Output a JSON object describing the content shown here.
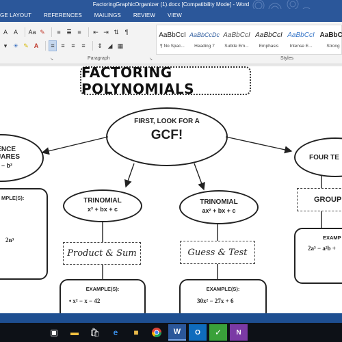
{
  "window": {
    "title": "FactoringGraphicOrganizer (1).docx [Compatibility Mode] - Word"
  },
  "ribbon": {
    "tabs": [
      "GE LAYOUT",
      "REFERENCES",
      "MAILINGS",
      "REVIEW",
      "VIEW"
    ],
    "groups": {
      "paragraph": "Paragraph",
      "styles": "Styles"
    },
    "font_row1": [
      "A",
      "A",
      "Aa",
      "✎"
    ],
    "styles_gallery": [
      {
        "sample": "AaBbCcI",
        "name": "¶ No Spac..."
      },
      {
        "sample": "AaBbCcDc",
        "name": "Heading 7"
      },
      {
        "sample": "AaBbCcI",
        "name": "Subtle Em..."
      },
      {
        "sample": "AaBbCcI",
        "name": "Emphasis"
      },
      {
        "sample": "AaBbCcI",
        "name": "Intense E..."
      },
      {
        "sample": "AaBbCc",
        "name": "Strong"
      }
    ]
  },
  "document": {
    "title": "FACTORING POLYNOMIALS",
    "gcf": {
      "line1": "FIRST, LOOK FOR A",
      "line2": "GCF!"
    },
    "left": {
      "line1": "RENCE",
      "line2": "UARES",
      "formula": "– b²",
      "example_label": "MPLE(S):",
      "example": "2n³"
    },
    "trinomial_a": {
      "title": "TRINOMIAL",
      "formula": "x² + bx + c",
      "method": "Product & Sum",
      "example_label": "EXAMPLE(S):",
      "example": "•  x² − x − 42"
    },
    "trinomial_b": {
      "title": "TRINOMIAL",
      "formula": "ax² + bx + c",
      "method": "Guess & Test",
      "example_label": "EXAMPLE(S):",
      "example": "30x² − 27x + 6"
    },
    "right": {
      "title": "FOUR TE",
      "method": "GROUP",
      "example_label": "EXAMP",
      "example": "2a³ − a²b +"
    }
  },
  "taskbar": {
    "icons": [
      "task-view-icon",
      "file-explorer-icon",
      "store-icon",
      "edge-icon",
      "folder-icon",
      "chrome-icon",
      "word-icon",
      "outlook-icon",
      "green-app-icon",
      "onenote-icon"
    ]
  }
}
